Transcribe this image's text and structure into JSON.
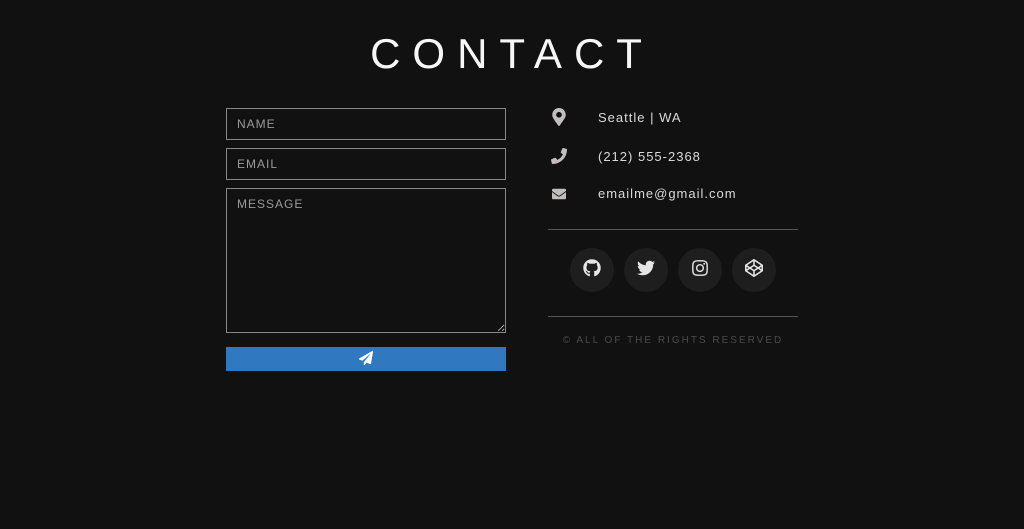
{
  "title": "CONTACT",
  "form": {
    "name_placeholder": "NAME",
    "email_placeholder": "EMAIL",
    "message_placeholder": "MESSAGE"
  },
  "info": {
    "location": "Seattle | WA",
    "phone": "(212) 555-2368",
    "email": "emailme@gmail.com"
  },
  "social": {
    "github": "github-icon",
    "twitter": "twitter-icon",
    "instagram": "instagram-icon",
    "codepen": "codepen-icon"
  },
  "copyright": "© ALL OF THE RIGHTS RESERVED"
}
